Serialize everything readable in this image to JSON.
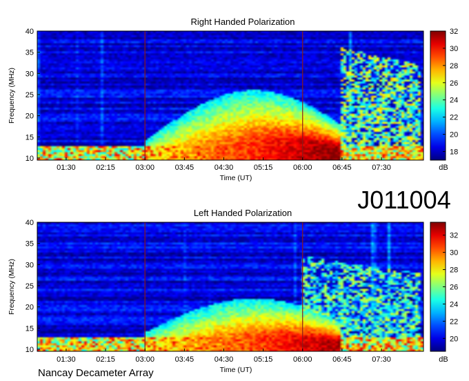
{
  "observation_id": "J011004",
  "credit": "Nancay Decameter Array",
  "chart_data": [
    {
      "type": "heatmap",
      "title": "Right Handed Polarization",
      "xlabel": "Time (UT)",
      "ylabel": "Frequency (MHz)",
      "x_ticks": [
        "01:30",
        "02:15",
        "03:00",
        "03:45",
        "04:30",
        "05:15",
        "06:00",
        "06:45",
        "07:30"
      ],
      "x_range_hours": [
        0.95,
        8.3
      ],
      "y_ticks": [
        10,
        15,
        20,
        25,
        30,
        35,
        40
      ],
      "ylim": [
        9.5,
        40
      ],
      "colorbar": {
        "label": "dB",
        "range": [
          17,
          32
        ],
        "ticks": [
          18,
          20,
          22,
          24,
          26,
          28,
          30,
          32
        ],
        "colormap": "jet"
      },
      "vertical_markers_ut": [
        "03:00",
        "06:00"
      ],
      "marker_color": "#8b1a1a",
      "emission_features": [
        {
          "region": "decreasing arc",
          "t_start": "03:00",
          "t_end": "06:45",
          "f_low": 10,
          "f_high": 26,
          "peak_db": 32
        },
        {
          "region": "late emission",
          "t_start": "06:45",
          "t_end": "08:15",
          "f_low": 10,
          "f_high": 36,
          "peak_db": 30
        }
      ]
    },
    {
      "type": "heatmap",
      "title": "Left Handed Polarization",
      "xlabel": "Time (UT)",
      "ylabel": "Frequency (MHz)",
      "x_ticks": [
        "01:30",
        "02:15",
        "03:00",
        "03:45",
        "04:30",
        "05:15",
        "06:00",
        "06:45",
        "07:30"
      ],
      "x_range_hours": [
        0.95,
        8.3
      ],
      "y_ticks": [
        10,
        15,
        20,
        25,
        30,
        35,
        40
      ],
      "ylim": [
        9.5,
        40
      ],
      "colorbar": {
        "label": "dB",
        "range": [
          18.5,
          33.5
        ],
        "ticks": [
          20,
          22,
          24,
          26,
          28,
          30,
          32
        ],
        "colormap": "jet"
      },
      "vertical_markers_ut": [
        "03:00",
        "06:00"
      ],
      "marker_color": "#8b1a1a",
      "emission_features": [
        {
          "region": "decreasing arc",
          "t_start": "03:00",
          "t_end": "06:45",
          "f_low": 10,
          "f_high": 22,
          "peak_db": 33
        },
        {
          "region": "late emission",
          "t_start": "06:00",
          "t_end": "08:15",
          "f_low": 10,
          "f_high": 32,
          "peak_db": 30
        }
      ]
    }
  ]
}
